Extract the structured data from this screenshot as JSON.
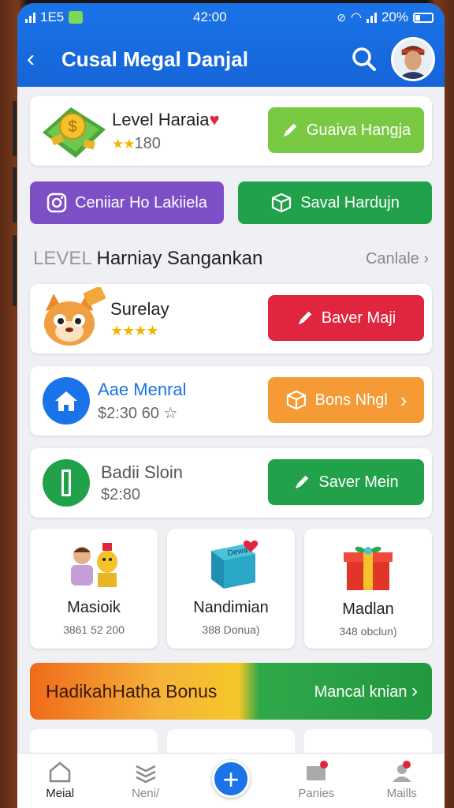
{
  "status": {
    "left": "1E5",
    "time": "42:00",
    "battery": "20%"
  },
  "appbar": {
    "title": "Cusal Megal Danjal"
  },
  "profile_card": {
    "name": "Level Haraia",
    "heart": "♥",
    "stars": "★★",
    "value": "180",
    "button": "Guaiva Hangja"
  },
  "quick_actions": [
    {
      "label": "Ceniiar Ho Lakiiela",
      "icon": "instagram-icon"
    },
    {
      "label": "Saval Hardujn",
      "icon": "box-icon"
    }
  ],
  "section": {
    "prefix": "LEVEL",
    "title": "Harniay Sangankan",
    "more": "Canlale",
    "more_arrow": "›"
  },
  "list": [
    {
      "name": "Surelay",
      "stars": "★★★★",
      "sub": "",
      "button": "Baver Maji",
      "color": "#e0263e"
    },
    {
      "name": "Aae Menral",
      "sub": "$2:30 60 ☆",
      "button": "Bons Nhgl",
      "color": "#f59a35",
      "arrow": "›"
    },
    {
      "name": "Badii Sloin",
      "sub": "$2:80",
      "button": "Saver Mein",
      "color": "#20a14a"
    }
  ],
  "tiles": [
    {
      "name": "Masioik",
      "sub": "3861 52 200"
    },
    {
      "name": "Nandimian",
      "sub": "388 Donua)",
      "box_text": "Dewa"
    },
    {
      "name": "Madlan",
      "sub": "348 obclun)"
    }
  ],
  "bonus": {
    "title": "HadikahHatha Bonus",
    "link": "Mancal knian",
    "arrow": "›"
  },
  "nav": [
    {
      "label": "Meial"
    },
    {
      "label": "Neni/"
    },
    {
      "label": "+"
    },
    {
      "label": "Panies"
    },
    {
      "label": "Maills"
    }
  ]
}
